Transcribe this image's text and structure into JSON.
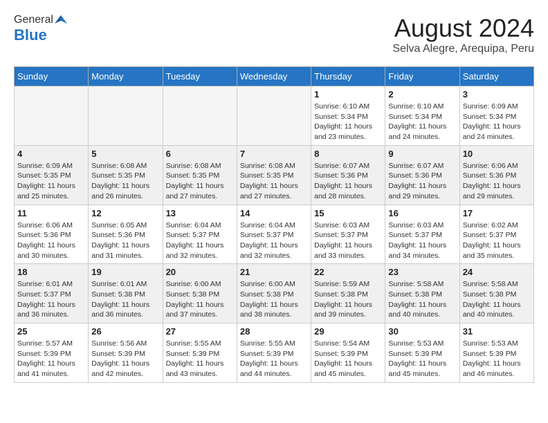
{
  "header": {
    "logo_general": "General",
    "logo_blue": "Blue",
    "month_title": "August 2024",
    "location": "Selva Alegre, Arequipa, Peru"
  },
  "days_of_week": [
    "Sunday",
    "Monday",
    "Tuesday",
    "Wednesday",
    "Thursday",
    "Friday",
    "Saturday"
  ],
  "weeks": [
    [
      {
        "day": "",
        "info": ""
      },
      {
        "day": "",
        "info": ""
      },
      {
        "day": "",
        "info": ""
      },
      {
        "day": "",
        "info": ""
      },
      {
        "day": "1",
        "info": "Sunrise: 6:10 AM\nSunset: 5:34 PM\nDaylight: 11 hours\nand 23 minutes."
      },
      {
        "day": "2",
        "info": "Sunrise: 6:10 AM\nSunset: 5:34 PM\nDaylight: 11 hours\nand 24 minutes."
      },
      {
        "day": "3",
        "info": "Sunrise: 6:09 AM\nSunset: 5:34 PM\nDaylight: 11 hours\nand 24 minutes."
      }
    ],
    [
      {
        "day": "4",
        "info": "Sunrise: 6:09 AM\nSunset: 5:35 PM\nDaylight: 11 hours\nand 25 minutes."
      },
      {
        "day": "5",
        "info": "Sunrise: 6:08 AM\nSunset: 5:35 PM\nDaylight: 11 hours\nand 26 minutes."
      },
      {
        "day": "6",
        "info": "Sunrise: 6:08 AM\nSunset: 5:35 PM\nDaylight: 11 hours\nand 27 minutes."
      },
      {
        "day": "7",
        "info": "Sunrise: 6:08 AM\nSunset: 5:35 PM\nDaylight: 11 hours\nand 27 minutes."
      },
      {
        "day": "8",
        "info": "Sunrise: 6:07 AM\nSunset: 5:36 PM\nDaylight: 11 hours\nand 28 minutes."
      },
      {
        "day": "9",
        "info": "Sunrise: 6:07 AM\nSunset: 5:36 PM\nDaylight: 11 hours\nand 29 minutes."
      },
      {
        "day": "10",
        "info": "Sunrise: 6:06 AM\nSunset: 5:36 PM\nDaylight: 11 hours\nand 29 minutes."
      }
    ],
    [
      {
        "day": "11",
        "info": "Sunrise: 6:06 AM\nSunset: 5:36 PM\nDaylight: 11 hours\nand 30 minutes."
      },
      {
        "day": "12",
        "info": "Sunrise: 6:05 AM\nSunset: 5:36 PM\nDaylight: 11 hours\nand 31 minutes."
      },
      {
        "day": "13",
        "info": "Sunrise: 6:04 AM\nSunset: 5:37 PM\nDaylight: 11 hours\nand 32 minutes."
      },
      {
        "day": "14",
        "info": "Sunrise: 6:04 AM\nSunset: 5:37 PM\nDaylight: 11 hours\nand 32 minutes."
      },
      {
        "day": "15",
        "info": "Sunrise: 6:03 AM\nSunset: 5:37 PM\nDaylight: 11 hours\nand 33 minutes."
      },
      {
        "day": "16",
        "info": "Sunrise: 6:03 AM\nSunset: 5:37 PM\nDaylight: 11 hours\nand 34 minutes."
      },
      {
        "day": "17",
        "info": "Sunrise: 6:02 AM\nSunset: 5:37 PM\nDaylight: 11 hours\nand 35 minutes."
      }
    ],
    [
      {
        "day": "18",
        "info": "Sunrise: 6:01 AM\nSunset: 5:37 PM\nDaylight: 11 hours\nand 36 minutes."
      },
      {
        "day": "19",
        "info": "Sunrise: 6:01 AM\nSunset: 5:38 PM\nDaylight: 11 hours\nand 36 minutes."
      },
      {
        "day": "20",
        "info": "Sunrise: 6:00 AM\nSunset: 5:38 PM\nDaylight: 11 hours\nand 37 minutes."
      },
      {
        "day": "21",
        "info": "Sunrise: 6:00 AM\nSunset: 5:38 PM\nDaylight: 11 hours\nand 38 minutes."
      },
      {
        "day": "22",
        "info": "Sunrise: 5:59 AM\nSunset: 5:38 PM\nDaylight: 11 hours\nand 39 minutes."
      },
      {
        "day": "23",
        "info": "Sunrise: 5:58 AM\nSunset: 5:38 PM\nDaylight: 11 hours\nand 40 minutes."
      },
      {
        "day": "24",
        "info": "Sunrise: 5:58 AM\nSunset: 5:38 PM\nDaylight: 11 hours\nand 40 minutes."
      }
    ],
    [
      {
        "day": "25",
        "info": "Sunrise: 5:57 AM\nSunset: 5:39 PM\nDaylight: 11 hours\nand 41 minutes."
      },
      {
        "day": "26",
        "info": "Sunrise: 5:56 AM\nSunset: 5:39 PM\nDaylight: 11 hours\nand 42 minutes."
      },
      {
        "day": "27",
        "info": "Sunrise: 5:55 AM\nSunset: 5:39 PM\nDaylight: 11 hours\nand 43 minutes."
      },
      {
        "day": "28",
        "info": "Sunrise: 5:55 AM\nSunset: 5:39 PM\nDaylight: 11 hours\nand 44 minutes."
      },
      {
        "day": "29",
        "info": "Sunrise: 5:54 AM\nSunset: 5:39 PM\nDaylight: 11 hours\nand 45 minutes."
      },
      {
        "day": "30",
        "info": "Sunrise: 5:53 AM\nSunset: 5:39 PM\nDaylight: 11 hours\nand 45 minutes."
      },
      {
        "day": "31",
        "info": "Sunrise: 5:53 AM\nSunset: 5:39 PM\nDaylight: 11 hours\nand 46 minutes."
      }
    ]
  ]
}
